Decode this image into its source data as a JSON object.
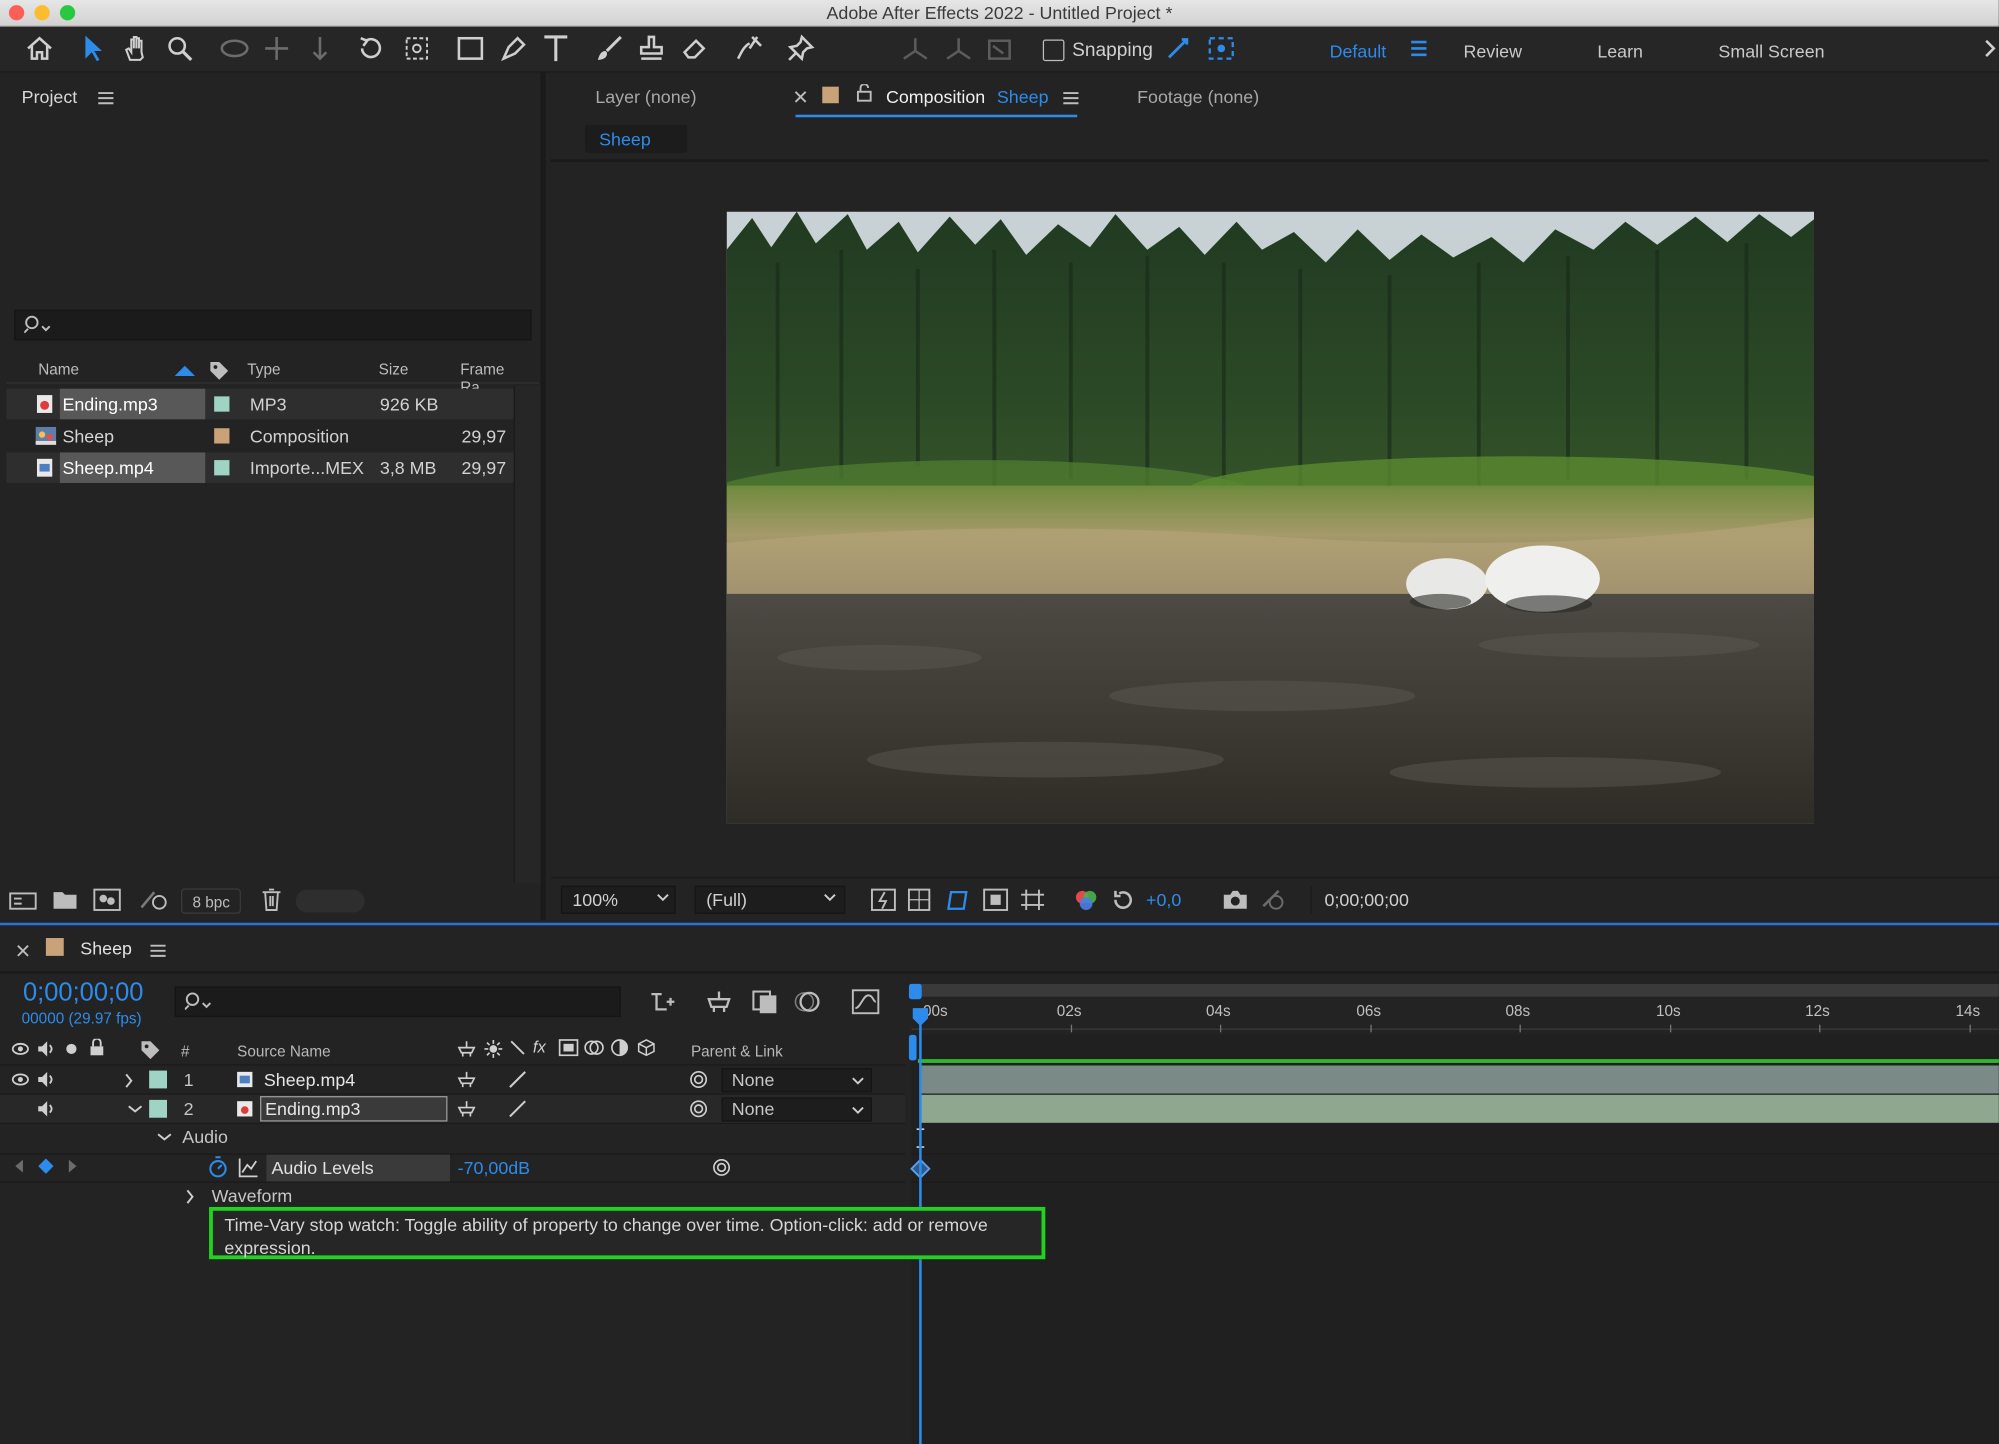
{
  "window": {
    "title": "Adobe After Effects 2022 - Untitled Project *"
  },
  "toolbar": {
    "snapping_label": "Snapping",
    "workspaces": [
      "Default",
      "Review",
      "Learn",
      "Small Screen"
    ]
  },
  "project": {
    "title": "Project",
    "columns": [
      "Name",
      "Type",
      "Size",
      "Frame Ra..."
    ],
    "items": [
      {
        "name": "Ending.mp3",
        "type": "MP3",
        "size": "926 KB",
        "frame_rate": "",
        "label_color": "#9fd3c4",
        "icon": "audio-file-icon"
      },
      {
        "name": "Sheep",
        "type": "Composition",
        "size": "",
        "frame_rate": "29,97",
        "label_color": "#c9a27a",
        "icon": "composition-icon"
      },
      {
        "name": "Sheep.mp4",
        "type": "Importe...MEX",
        "size": "3,8 MB",
        "frame_rate": "29,97",
        "label_color": "#9fd3c4",
        "icon": "video-file-icon"
      }
    ],
    "bpc": "8 bpc"
  },
  "comp_panel": {
    "tabs": [
      "Layer (none)",
      "Composition",
      "Sheep",
      "Footage (none)"
    ],
    "breadcrumb": "Sheep",
    "zoom": "100%",
    "resolution": "(Full)",
    "exposure": "+0,0",
    "timecode": "0;00;00;00"
  },
  "timeline": {
    "comp_name": "Sheep",
    "timecode": "0;00;00;00",
    "frame_info": "00000 (29.97 fps)",
    "columns": [
      "#",
      "Source Name",
      "Parent & Link"
    ],
    "ruler": [
      "00s",
      "02s",
      "04s",
      "06s",
      "08s",
      "10s",
      "12s",
      "14s"
    ],
    "layers": [
      {
        "num": "1",
        "name": "Sheep.mp4",
        "parent": "None"
      },
      {
        "num": "2",
        "name": "Ending.mp3",
        "parent": "None"
      }
    ],
    "audio_group": "Audio",
    "audio_levels_label": "Audio Levels",
    "audio_levels_value": "-70,00dB",
    "waveform_label": "Waveform",
    "tooltip": "Time-Vary stop watch: Toggle ability of property to change over time. Option-click: add or remove expression."
  },
  "colors": {
    "accent_blue": "#2d8ceb",
    "highlight_green": "#1fd31f",
    "layer_bar_green": "#2fb82f"
  }
}
